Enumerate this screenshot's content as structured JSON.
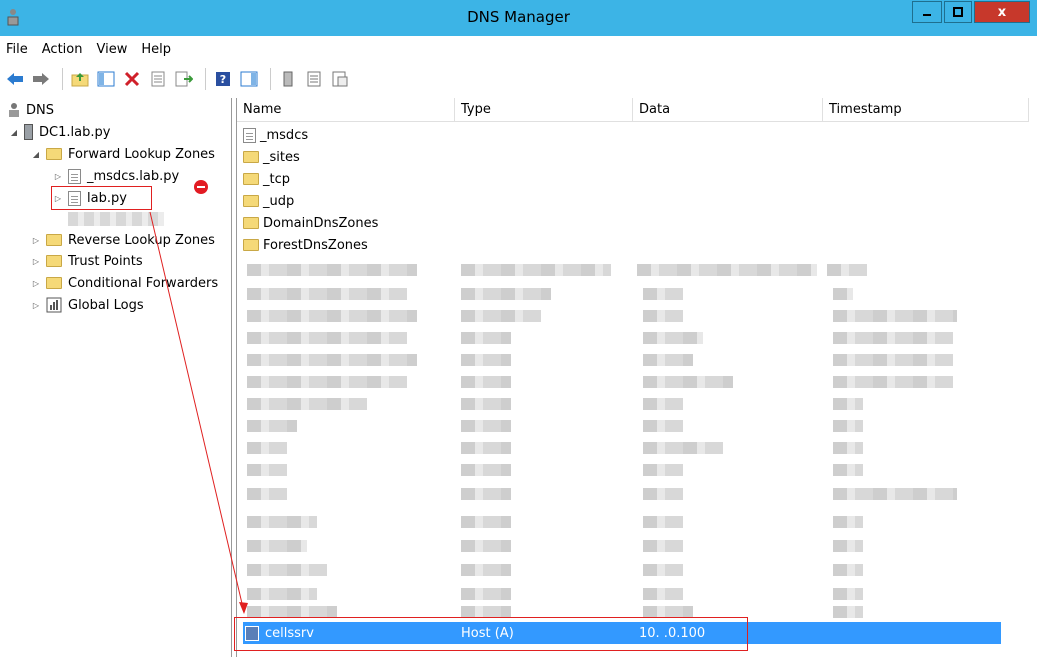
{
  "window": {
    "title": "DNS Manager",
    "close_label": "x"
  },
  "menu": [
    "File",
    "Action",
    "View",
    "Help"
  ],
  "tree": {
    "root": "DNS",
    "server": "DC1.lab.py",
    "forward": "Forward Lookup Zones",
    "zone_msdcs": "_msdcs.lab.py",
    "zone_lab": "lab.py",
    "reverse": "Reverse Lookup Zones",
    "trust": "Trust Points",
    "conditional": "Conditional Forwarders",
    "logs": "Global Logs"
  },
  "columns": [
    "Name",
    "Type",
    "Data",
    "Timestamp"
  ],
  "folder_rows": [
    "_msdcs",
    "_sites",
    "_tcp",
    "_udp",
    "DomainDnsZones",
    "ForestDnsZones"
  ],
  "selected_record": {
    "name": "cellssrv",
    "type": "Host (A)",
    "data": "10.   .0.100"
  },
  "colors": {
    "titlebar": "#3cb4e6",
    "selection": "#3399ff",
    "annotation": "#e02020",
    "close": "#c7382b"
  }
}
